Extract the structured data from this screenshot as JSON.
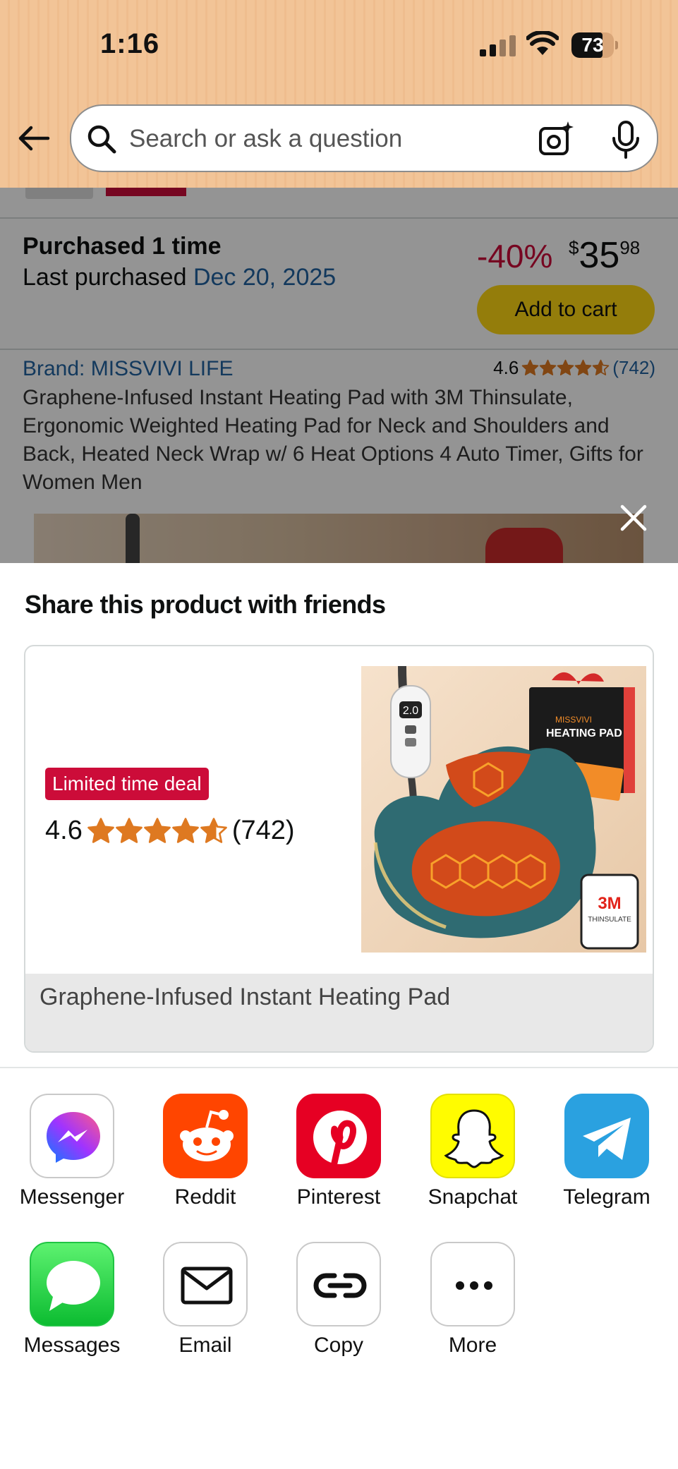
{
  "status_bar": {
    "time": "1:16",
    "battery": "73"
  },
  "search": {
    "placeholder": "Search or ask a question"
  },
  "background_page": {
    "purchased_title": "Purchased 1 time",
    "last_purchased_label": "Last purchased ",
    "last_purchased_date": "Dec 20, 2025",
    "discount": "-40%",
    "price_currency": "$",
    "price_whole": "35",
    "price_fraction": "98",
    "add_to_cart": "Add to cart",
    "brand": "Brand: MISSVIVI LIFE",
    "rating": "4.6",
    "rating_count": "(742)",
    "product_title": "Graphene-Infused Instant Heating Pad with 3M Thinsulate, Ergonomic Weighted Heating Pad for Neck and Shoulders and Back, Heated Neck Wrap w/ 6 Heat Options 4 Auto Timer, Gifts for Women Men"
  },
  "share_sheet": {
    "title": "Share this product with friends",
    "card": {
      "deal_badge": "Limited time deal",
      "rating": "4.6",
      "rating_count": "(742)",
      "product_name": "Graphene-Infused Instant Heating Pad",
      "image_labels": {
        "remote_display": "2.0",
        "box_brand": "MISSVIVI",
        "box_title": "HEATING PAD",
        "tag_brand": "3M",
        "tag_text": "THINSULATE"
      }
    },
    "apps": [
      {
        "label": "Messenger",
        "icon": "messenger-icon"
      },
      {
        "label": "Reddit",
        "icon": "reddit-icon"
      },
      {
        "label": "Pinterest",
        "icon": "pinterest-icon"
      },
      {
        "label": "Snapchat",
        "icon": "snapchat-icon"
      },
      {
        "label": "Telegram",
        "icon": "telegram-icon"
      },
      {
        "label": "Messages",
        "icon": "messages-icon"
      },
      {
        "label": "Email",
        "icon": "email-icon"
      },
      {
        "label": "Copy",
        "icon": "link-icon"
      },
      {
        "label": "More",
        "icon": "more-icon"
      }
    ]
  },
  "colors": {
    "header_bg": "#f2c497",
    "deal_red": "#cc0c39",
    "link_blue": "#2162a1",
    "star_orange": "#de7921",
    "cart_yellow": "#ffd814"
  }
}
